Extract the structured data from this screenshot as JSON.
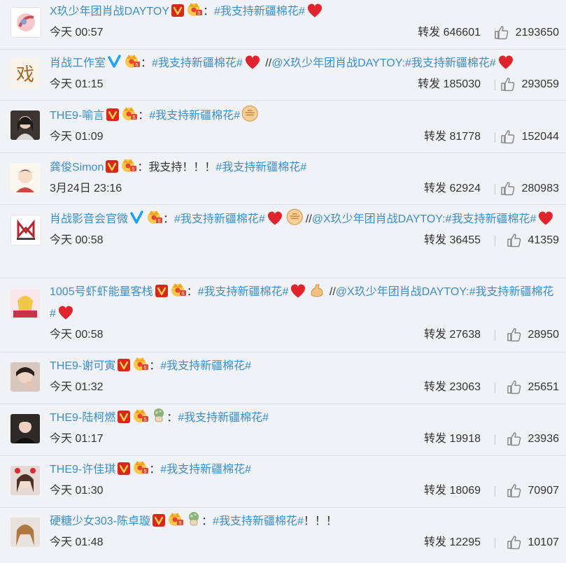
{
  "posts": [
    {
      "name": "X玖少年团肖战DAYTOY",
      "colon": "：",
      "topic": "#我支持新疆棉花#",
      "time": "今天 00:57",
      "forward_label": "转发",
      "forwards": "646601",
      "likes": "2193650"
    },
    {
      "name": "肖战工作室",
      "colon": "：",
      "topic": "#我支持新疆棉花#",
      "repost_prefix": "//",
      "mention": "@X玖少年团肖战DAYTOY",
      "mention_colon": ":",
      "topic2": "#我支持新疆棉花#",
      "time": "今天 01:15",
      "forward_label": "转发",
      "forwards": "185030",
      "likes": "293059"
    },
    {
      "name": "THE9-喻言",
      "colon": "：",
      "topic": "#我支持新疆棉花#",
      "time": "今天 01:09",
      "forward_label": "转发",
      "forwards": "81778",
      "likes": "152044"
    },
    {
      "name": "龚俊Simon",
      "colon": "：",
      "prefix": "我支持！！！",
      "topic": "#我支持新疆棉花#",
      "time": "3月24日 23:16",
      "forward_label": "转发",
      "forwards": "62924",
      "likes": "280983"
    },
    {
      "name": "肖战影音会官微",
      "colon": "：",
      "topic": "#我支持新疆棉花#",
      "repost_prefix": "//",
      "mention": "@X玖少年团肖战DAYTOY",
      "mention_colon": ":",
      "topic2": "#我支持新疆棉花#",
      "time": "今天 00:58",
      "forward_label": "转发",
      "forwards": "36455",
      "likes": "41359"
    },
    {
      "name": "1005号虾虾能量客栈",
      "colon": "：",
      "topic": "#我支持新疆棉花#",
      "repost_prefix": "//",
      "mention": "@X玖少年团肖战DAYTOY",
      "mention_colon": ":",
      "topic2": "#我支持新疆棉花#",
      "time": "今天 00:58",
      "forward_label": "转发",
      "forwards": "27638",
      "likes": "28950"
    },
    {
      "name": "THE9-谢可寅",
      "colon": "：",
      "topic": "#我支持新疆棉花#",
      "time": "今天 01:32",
      "forward_label": "转发",
      "forwards": "23063",
      "likes": "25651"
    },
    {
      "name": "THE9-陆柯燃",
      "colon": "：",
      "topic": "#我支持新疆棉花#",
      "time": "今天 01:17",
      "forward_label": "转发",
      "forwards": "19918",
      "likes": "23936"
    },
    {
      "name": "THE9-许佳琪",
      "colon": "：",
      "topic": "#我支持新疆棉花#",
      "time": "今天 01:30",
      "forward_label": "转发",
      "forwards": "18069",
      "likes": "70907"
    },
    {
      "name": "硬糖少女303-陈卓璇",
      "colon": "：",
      "topic": "#我支持新疆棉花#",
      "suffix": "！！！",
      "time": "今天 01:48",
      "forward_label": "转发",
      "forwards": "12295",
      "likes": "10107"
    }
  ],
  "colors": {
    "link": "#3a8fcb",
    "background": "#f1f2f5",
    "heart": "#e0242e",
    "vip_badge": "#d9281a",
    "blue_v": "#1da1f2"
  },
  "icons": [
    "heart-emoji",
    "fist-emoji",
    "muscle-emoji",
    "thumbs-up-icon",
    "verified-badge-icon",
    "vip-crown-icon",
    "avatar"
  ]
}
